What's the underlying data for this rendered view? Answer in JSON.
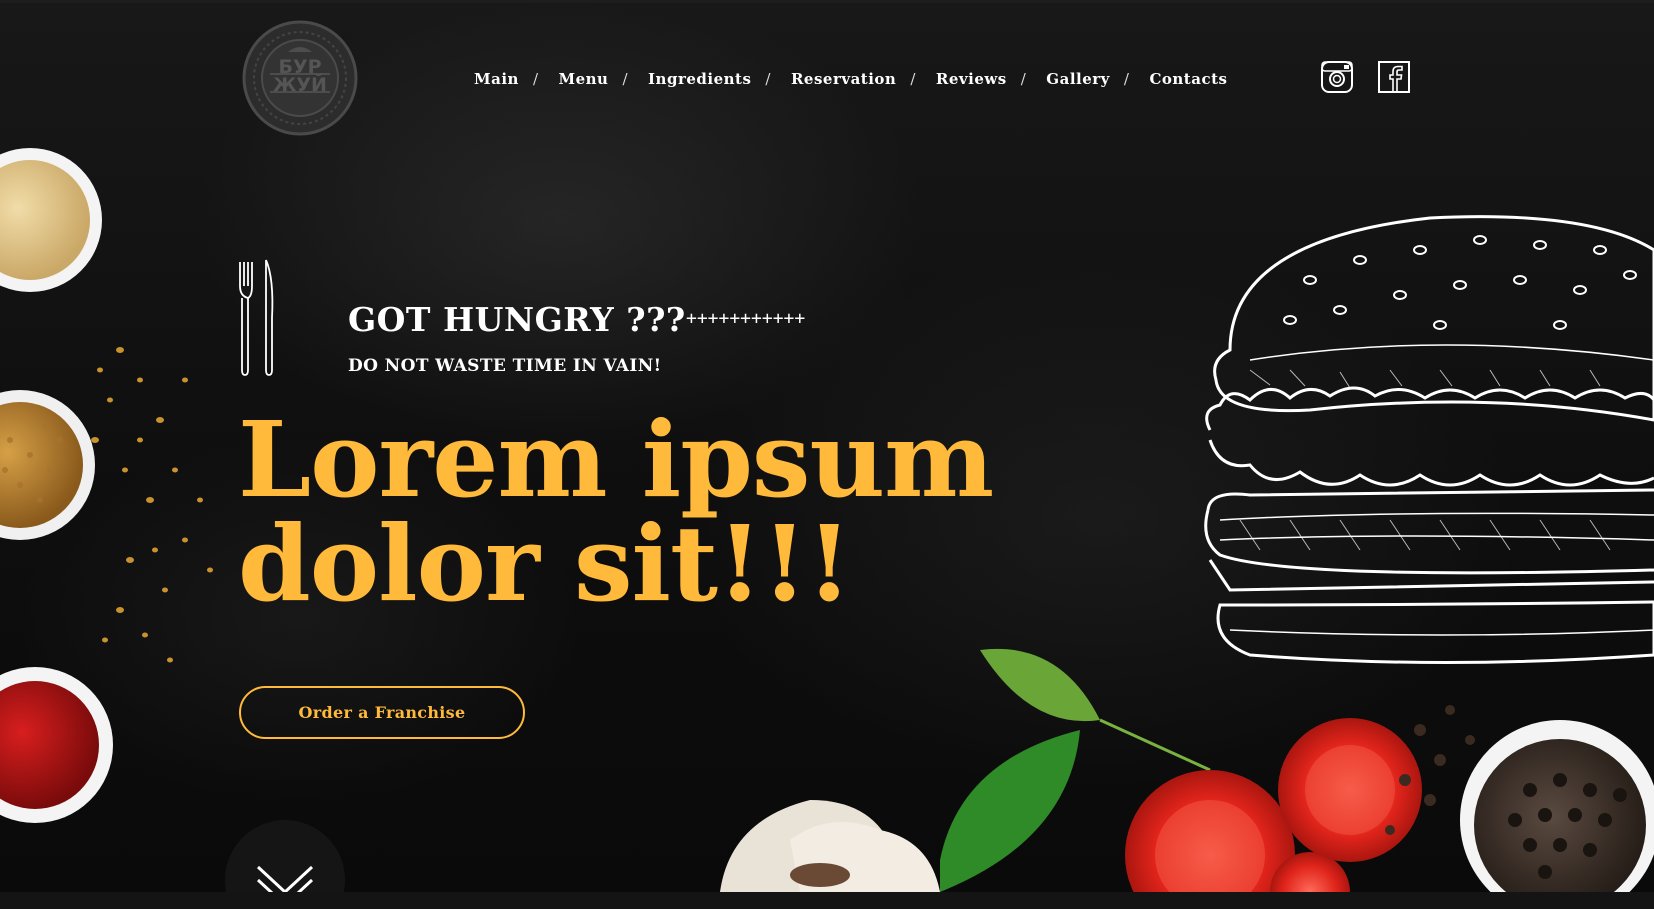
{
  "brand": {
    "logo_alt": "БУР ЖУЙ logo"
  },
  "nav": {
    "items": [
      {
        "label": "Main"
      },
      {
        "label": "Menu"
      },
      {
        "label": "Ingredients"
      },
      {
        "label": "Reservation"
      },
      {
        "label": "Reviews"
      },
      {
        "label": "Gallery"
      },
      {
        "label": "Contacts"
      }
    ],
    "separator": "/"
  },
  "social": {
    "instagram_icon": "instagram-icon",
    "facebook_icon": "facebook-icon"
  },
  "hero": {
    "tagline": "GOT HUNGRY ???",
    "pluses": "+++++++++++",
    "subtag": "DO NOT WASTE TIME IN VAIN!",
    "headline_line1": "Lorem ipsum",
    "headline_line2": "dolor sit!!!",
    "cta_label": "Order a Franchise"
  },
  "colors": {
    "accent": "#ffb93b",
    "background": "#111111",
    "text": "#ffffff"
  }
}
